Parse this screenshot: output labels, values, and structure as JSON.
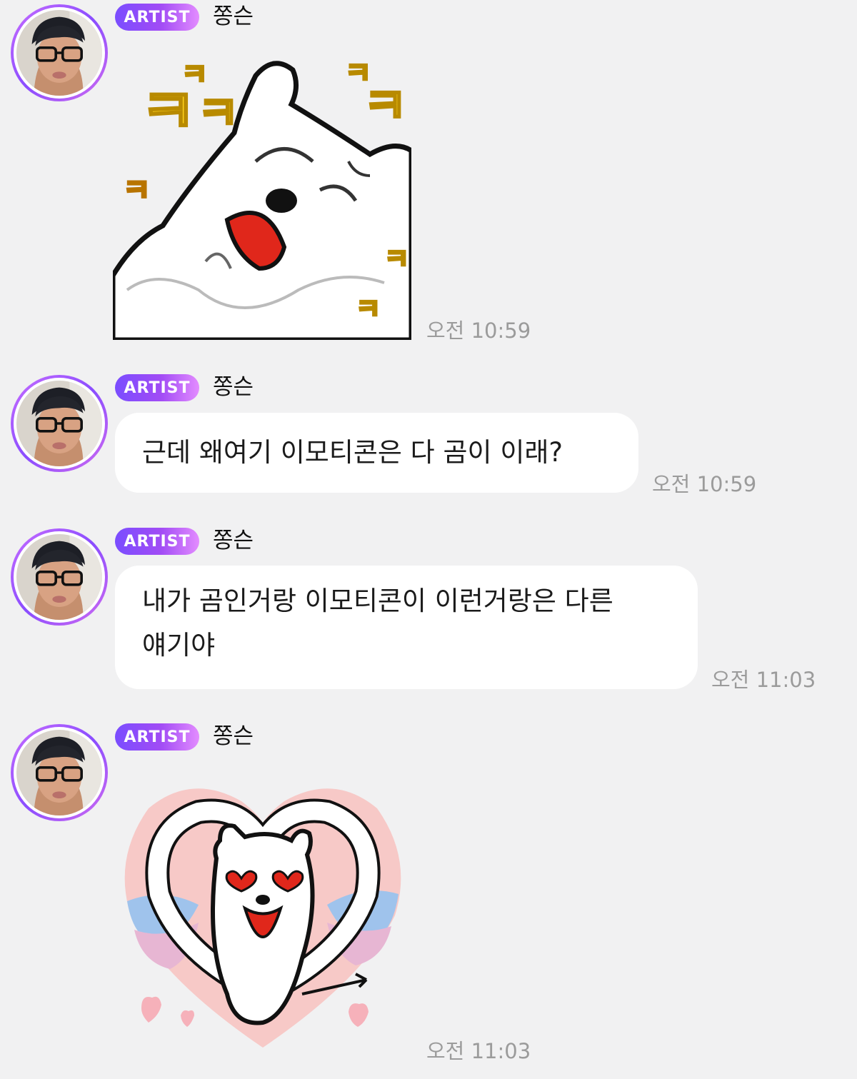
{
  "messages": [
    {
      "badge": "ARTIST",
      "sender": "쫑슨",
      "type": "sticker",
      "sticker_name": "laughing-bear-sticker",
      "time": "오전 10:59"
    },
    {
      "badge": "ARTIST",
      "sender": "쫑슨",
      "type": "text",
      "text": "근데 왜여기 이모티콘은 다 곰이 이래?",
      "time": "오전 10:59"
    },
    {
      "badge": "ARTIST",
      "sender": "쫑슨",
      "type": "text",
      "text_line1": "내가 곰인거랑 이모티콘이 이런거랑은 다른",
      "text_line2": "얘기야",
      "time": "오전 11:03"
    },
    {
      "badge": "ARTIST",
      "sender": "쫑슨",
      "type": "sticker",
      "sticker_name": "heart-cupid-bear-sticker",
      "time": "오전 11:03"
    }
  ],
  "sticker_text": {
    "kk": "ㅋ"
  },
  "colors": {
    "background": "#f1f1f2",
    "badge_start": "#7a4dff",
    "badge_end": "#e38cff",
    "bubble": "#ffffff",
    "timestamp": "#9b9b9b"
  }
}
